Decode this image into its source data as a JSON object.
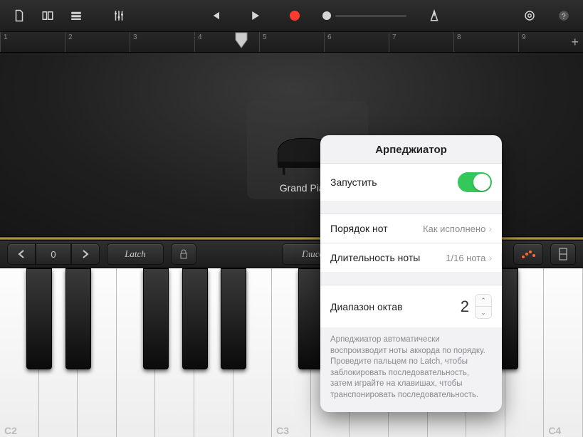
{
  "toolbar": {
    "icons": {
      "new": "document-icon",
      "browser": "browser-icon",
      "tracks": "tracks-icon",
      "mixer": "sliders-icon",
      "rewind": "rewind-icon",
      "play": "play-icon",
      "record": "record-icon",
      "metronome": "metronome-icon",
      "settings": "gear-icon",
      "help": "help-icon"
    }
  },
  "ruler": {
    "bars": [
      "1",
      "2",
      "3",
      "4",
      "5",
      "6",
      "7",
      "8",
      "9"
    ]
  },
  "instrument": {
    "name": "Grand Piano"
  },
  "strip": {
    "octave_value": "0",
    "latch_label": "Latch",
    "gliss_label": "Глиссандо"
  },
  "keyboard": {
    "labels": [
      "C2",
      "C3",
      "C4"
    ]
  },
  "popover": {
    "title": "Арпеджиатор",
    "run_label": "Запустить",
    "order_label": "Порядок нот",
    "order_value": "Как исполнено",
    "rate_label": "Длительность ноты",
    "rate_value": "1/16 нота",
    "range_label": "Диапазон октав",
    "range_value": "2",
    "description": "Арпеджиатор автоматически воспроизводит ноты аккорда по порядку. Проведите пальцем по Latch, чтобы заблокировать последовательность, затем играйте на клавишах, чтобы транспонировать последовательность."
  }
}
